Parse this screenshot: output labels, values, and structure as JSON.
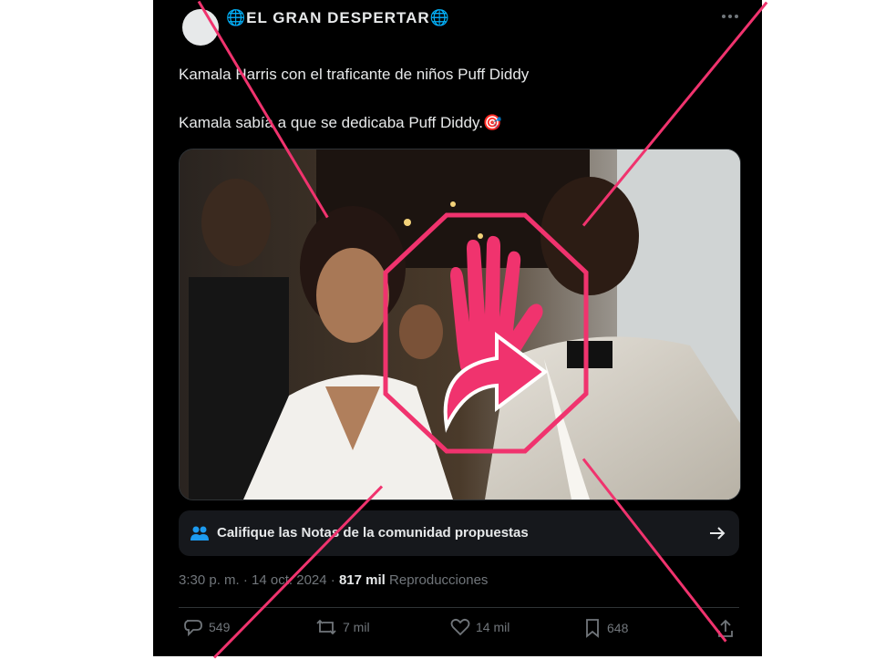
{
  "post": {
    "author_name": "🌐EL GRAN DESPERTAR🌐",
    "text_line1": "Kamala Harris con el traficante de niños  Puff Diddy",
    "text_line2": "Kamala sabía a que se dedicaba Puff Diddy.🎯",
    "community_notes_label": "Califique las Notas de la comunidad propuestas",
    "time": "3:30 p. m.",
    "sep1": " · ",
    "date": "14 oct. 2024",
    "sep2": " · ",
    "views_count": "817 mil",
    "views_label": "Reproducciones"
  },
  "actions": {
    "replies": "549",
    "reposts": "7 mil",
    "likes": "14 mil",
    "bookmarks": "648"
  },
  "icons": {
    "more": "more-horizontal-icon",
    "community": "people-icon",
    "arrow": "arrow-right-icon",
    "reply": "reply-icon",
    "repost": "repost-icon",
    "like": "heart-icon",
    "bookmark": "bookmark-icon",
    "share": "share-icon",
    "stamp": "stop-hand-arrow-icon"
  },
  "colors": {
    "background": "#000000",
    "text": "#e7e9ea",
    "muted": "#71767b",
    "notes_bg": "#16181c",
    "community_blue": "#1d9bf0",
    "overlay_pink": "#f0336e"
  }
}
